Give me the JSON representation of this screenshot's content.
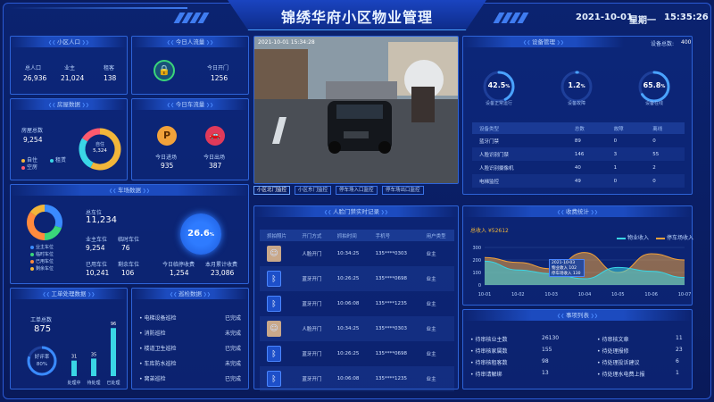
{
  "header": {
    "title": "锦绣华府小区物业管理",
    "date": "2021-10-01",
    "weekday": "星期一",
    "time": "15:35:26"
  },
  "population": {
    "title": "小区人口",
    "items": [
      {
        "label": "总人口",
        "value": "26,936"
      },
      {
        "label": "业主",
        "value": "21,024"
      },
      {
        "label": "租客",
        "value": "138"
      }
    ]
  },
  "traffic_people": {
    "title": "今日人流量",
    "label": "今日开门",
    "value": "1256",
    "icon": "lock-icon"
  },
  "house": {
    "title": "房屋数据",
    "total_label": "房屋总数",
    "total": "9,254",
    "center_label": "自住",
    "center_value": "5,324",
    "legend": [
      "自住",
      "租赁",
      "空房"
    ],
    "values": [
      5324,
      2430,
      1500
    ],
    "colors": [
      "#f2b63a",
      "#3ad6e6",
      "#ff5a6e"
    ]
  },
  "vehicle_traffic": {
    "title": "今日车流量",
    "in_label": "今日进场",
    "in_value": "935",
    "out_label": "今日出场",
    "out_value": "387"
  },
  "video": {
    "timestamp": "2021-10-01  15:34:28",
    "tabs": [
      "小区北门监控",
      "小区东门监控",
      "停车场入口监控",
      "停车场出口监控"
    ]
  },
  "device": {
    "title": "设备管理",
    "total_label": "设备总数:",
    "total": "400",
    "gauges": [
      {
        "pct": "42.5",
        "unit": "%",
        "label": "设备正常运行",
        "value": 0.425
      },
      {
        "pct": "1.2",
        "unit": "%",
        "label": "设备故障",
        "value": 0.012
      },
      {
        "pct": "65.8",
        "unit": "%",
        "label": "设备在线",
        "value": 0.658
      }
    ],
    "headers": [
      "设备类型",
      "总数",
      "故障",
      "离线"
    ],
    "rows": [
      [
        "蓝牙门禁",
        "89",
        "0",
        "0"
      ],
      [
        "人脸识别门禁",
        "146",
        "3",
        "55"
      ],
      [
        "人脸识别摄像机",
        "40",
        "1",
        "2"
      ],
      [
        "电梯监控",
        "49",
        "0",
        "0"
      ]
    ]
  },
  "parking": {
    "title": "车场数据",
    "total_label": "总车位",
    "total": "11,234",
    "items": [
      {
        "label": "业主车位",
        "value": "9,254"
      },
      {
        "label": "临时车位",
        "value": "76"
      },
      {
        "label": "已用车位",
        "value": "10,241"
      },
      {
        "label": "剩余车位",
        "value": "106"
      }
    ],
    "legend": [
      "业主车位",
      "临时车位",
      "已用车位",
      "剩余车位"
    ],
    "values": [
      9254,
      76,
      10241,
      106
    ],
    "colors": [
      "#3a8bff",
      "#3ad67a",
      "#ff8a3d",
      "#f2b63a"
    ],
    "rate_pct": "26.6",
    "rate_unit": "%",
    "fee_today_label": "今日临停收费",
    "fee_today": "1,254",
    "fee_month_label": "本月累计收费",
    "fee_month": "23,086"
  },
  "access": {
    "title": "人脸门禁实时记录",
    "headers": [
      "抓拍照片",
      "开门方式",
      "抓拍时间",
      "手机号",
      "用户类型"
    ],
    "rows": [
      {
        "type": "face",
        "method": "人脸开门",
        "time": "10:34:25",
        "phone": "135****0303",
        "user": "业主"
      },
      {
        "type": "bt",
        "method": "蓝牙开门",
        "time": "10:26:25",
        "phone": "135****0698",
        "user": "业主"
      },
      {
        "type": "bt",
        "method": "蓝牙开门",
        "time": "10:06:08",
        "phone": "135****1235",
        "user": "业主"
      },
      {
        "type": "face",
        "method": "人脸开门",
        "time": "10:34:25",
        "phone": "135****0303",
        "user": "业主"
      },
      {
        "type": "bt",
        "method": "蓝牙开门",
        "time": "10:26:25",
        "phone": "135****0698",
        "user": "业主"
      },
      {
        "type": "bt",
        "method": "蓝牙开门",
        "time": "10:06:08",
        "phone": "135****1235",
        "user": "业主"
      }
    ]
  },
  "income": {
    "title": "收费统计",
    "total_label": "总收入",
    "total": "¥52612",
    "legend": [
      "物业收入",
      "停车场收入"
    ],
    "tooltip": [
      "2021-10-03",
      "物业收入 102",
      "停车场收入 130"
    ]
  },
  "chart_data": {
    "type": "area",
    "categories": [
      "10-01",
      "10-02",
      "10-03",
      "10-04",
      "10-05",
      "10-06",
      "10-07"
    ],
    "ylim": [
      0,
      300
    ],
    "yticks": [
      "300",
      "200",
      "100",
      "0"
    ],
    "series": [
      {
        "name": "物业收入",
        "values": [
          190,
          120,
          90,
          50,
          140,
          110,
          60
        ],
        "color": "#3ad6e6"
      },
      {
        "name": "停车场收入",
        "values": [
          220,
          180,
          130,
          260,
          100,
          250,
          200
        ],
        "color": "#f2a23a"
      }
    ]
  },
  "workorder": {
    "title": "工单处理数据",
    "total_label": "工单总数",
    "total": "875",
    "rate_label": "好评率",
    "rate": "80%",
    "rate_value": 0.8,
    "bars": [
      {
        "label": "处理中",
        "value": 31
      },
      {
        "label": "待处理",
        "value": 35
      },
      {
        "label": "已处理",
        "value": 96
      }
    ]
  },
  "patrol": {
    "title": "巡检数据",
    "rows": [
      {
        "name": "电梯设备巡检",
        "status": "已完成",
        "ok": true
      },
      {
        "name": "消防巡检",
        "status": "未完成",
        "ok": false
      },
      {
        "name": "楼道卫生巡检",
        "status": "已完成",
        "ok": true
      },
      {
        "name": "车库防水巡检",
        "status": "未完成",
        "ok": false
      },
      {
        "name": "窝弟巡检",
        "status": "已完成",
        "ok": true
      }
    ]
  },
  "matters": {
    "title": "事项列表",
    "left": [
      {
        "name": "待审核业主数",
        "value": "26130"
      },
      {
        "name": "待审核家属数",
        "value": "155"
      },
      {
        "name": "待审核租客数",
        "value": "98"
      },
      {
        "name": "待审请解绑",
        "value": "13"
      }
    ],
    "right": [
      {
        "name": "待审核文章",
        "value": "11"
      },
      {
        "name": "待处理报修",
        "value": "23"
      },
      {
        "name": "待处理投诉建议",
        "value": "6"
      },
      {
        "name": "待处理水电费上报",
        "value": "1"
      }
    ]
  }
}
